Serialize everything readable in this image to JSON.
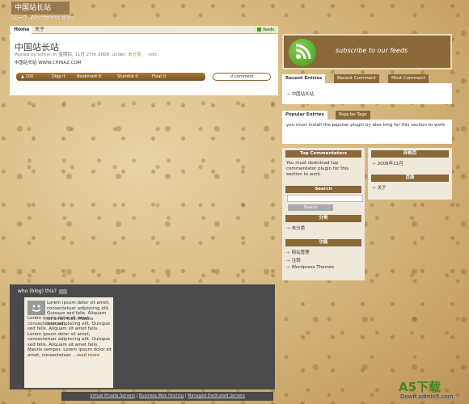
{
  "site": {
    "title": "中国站长站",
    "description": "又一个 Wordpress blog"
  },
  "nav": {
    "items": [
      "Home",
      "关于"
    ],
    "feeds": "feeds"
  },
  "post": {
    "title": "中国站长站",
    "meta_prefix": "Posted by",
    "author": "admin",
    "meta_date": "in 星期四, 11月 27th 2008",
    "meta_under": "under:",
    "category": "未分类",
    "edit": "edit",
    "body": "中国站长站  WWW.CHINAZ.COM",
    "bar_links": [
      "Digg it",
      "Bookmark it",
      "Stumble it",
      "Float it"
    ],
    "bar_count": "100",
    "comment": "comment"
  },
  "subscribe": {
    "text": "subscribe to our feeds"
  },
  "tabs1": {
    "items": [
      "Recent Entries",
      "Recent Comment",
      "Most Comment"
    ],
    "content": "中国站长站"
  },
  "tabs2": {
    "items": [
      "Popular Entries",
      "Popular Tags"
    ],
    "content": "you must install the popular plugin by alex king for this section to work"
  },
  "left_widgets": {
    "commentators": {
      "title": "Top Commentators",
      "text": "You must download top commentator plugin for this section to work"
    },
    "search": {
      "title": "Search",
      "button": "Search"
    },
    "categories": {
      "title": "分类",
      "items": [
        "未分类"
      ]
    },
    "functions": {
      "title": "功能",
      "items": [
        "网站管理",
        "注销",
        "Wordpress Themes"
      ]
    }
  },
  "right_widgets": {
    "archives": {
      "title": "存档页",
      "items": [
        "2008年11月"
      ]
    },
    "pages": {
      "title": "页面",
      "items": [
        "关于"
      ]
    }
  },
  "about": {
    "title": "who (blog) this?",
    "text_top": "Lorem ipsum dolor sit amet, consectetuer adipiscing elit. Quisque sed felis. Aliquam sit amet felis. Mauris semper,",
    "text_rest": "Lorem ipsum dolor sit amet, consectetuer adipiscing elit. Quisque sed felis. Aliquam sit amet felis. Lorem ipsum dolor sit amet, consectetuer adipiscing elit. Quisque sed felis. Aliquam sit amet felis. Mauris semper, Lorem ipsum dolor sit amet, consectetuer",
    "read_more": "...read more"
  },
  "footer": {
    "links": [
      "Virtual Private Servers",
      "Business Web Hosting",
      "Managed Dedicated Servers"
    ],
    "sep": "|"
  },
  "logo": {
    "main": "A5下载",
    "sub": "Down.admin5.com"
  }
}
